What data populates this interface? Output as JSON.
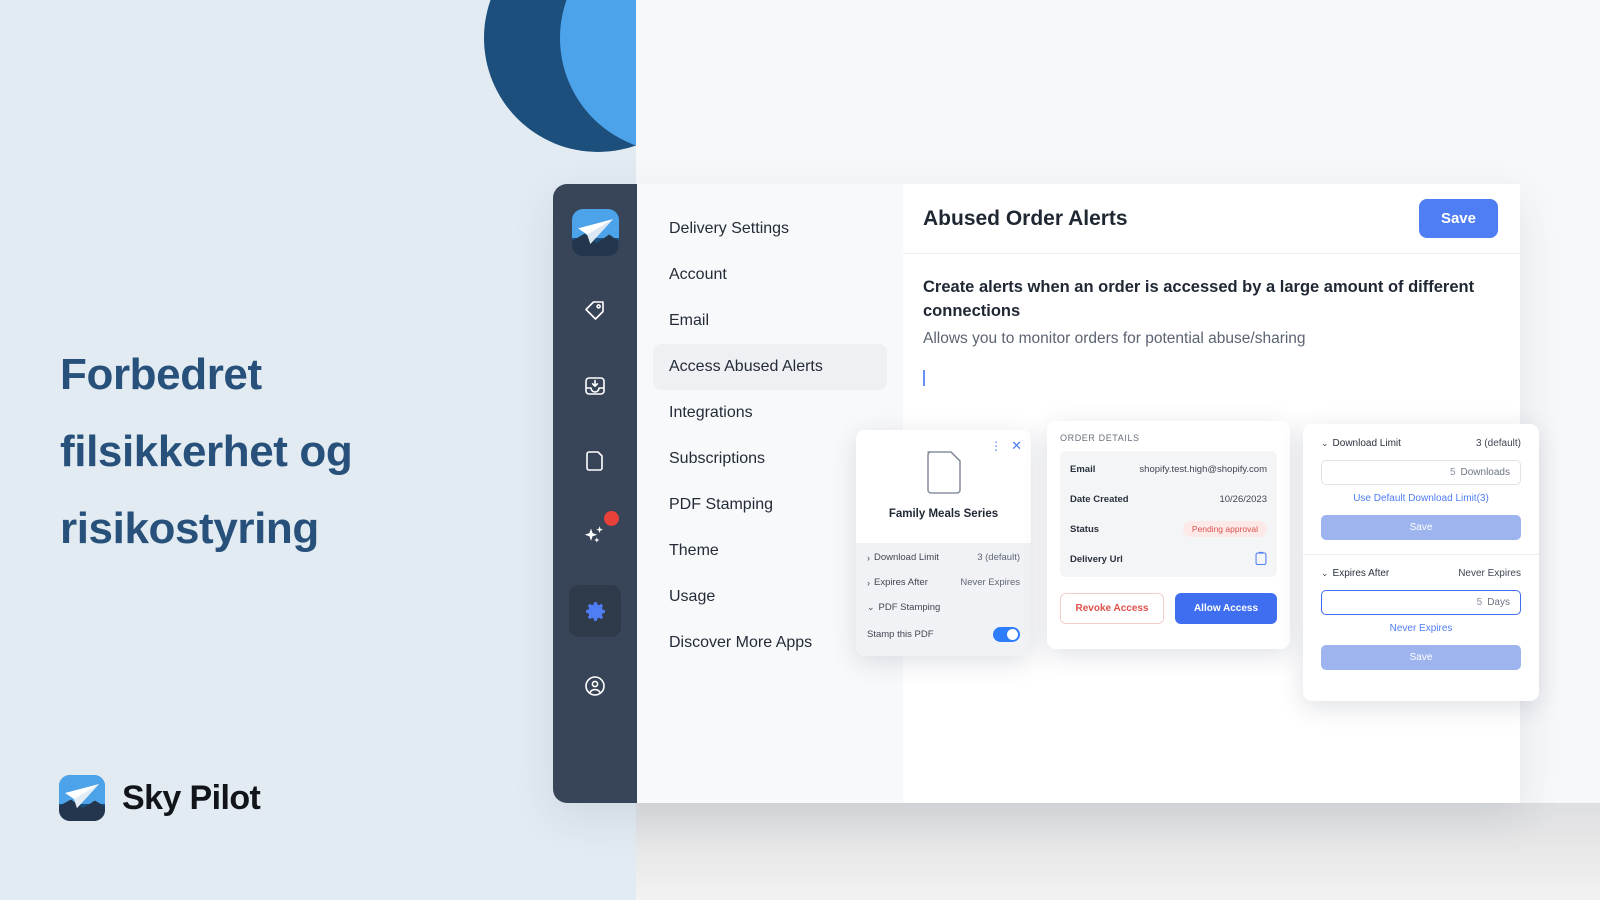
{
  "marketing": {
    "headline": "Forbedret filsikkerhet og risikostyring",
    "brand_name": "Sky Pilot",
    "brand_logo_icon": "paper-plane-logo-icon",
    "bg_color": "#e2ebf2",
    "headline_color": "#27517a",
    "circle_dark_color": "#1d4f7c",
    "circle_light_color": "#4da3ea"
  },
  "app": {
    "icon_rail": {
      "logo_icon": "sky-pilot-logo-icon",
      "items": [
        {
          "icon": "tag-icon",
          "active": false,
          "badge": false
        },
        {
          "icon": "inbox-download-icon",
          "active": false,
          "badge": false
        },
        {
          "icon": "document-icon",
          "active": false,
          "badge": false
        },
        {
          "icon": "sparkles-icon",
          "active": false,
          "badge": true
        },
        {
          "icon": "gear-icon",
          "active": true,
          "badge": false
        },
        {
          "icon": "account-circle-icon",
          "active": false,
          "badge": false
        }
      ],
      "active_icon_color": "#4f7df3",
      "badge_color": "#e8413a",
      "rail_bg": "#384457"
    },
    "settings_menu": {
      "items": [
        {
          "label": "Delivery Settings",
          "active": false
        },
        {
          "label": "Account",
          "active": false
        },
        {
          "label": "Email",
          "active": false
        },
        {
          "label": "Access Abused Alerts",
          "active": true
        },
        {
          "label": "Integrations",
          "active": false
        },
        {
          "label": "Subscriptions",
          "active": false
        },
        {
          "label": "PDF Stamping",
          "active": false
        },
        {
          "label": "Theme",
          "active": false
        },
        {
          "label": "Usage",
          "active": false
        },
        {
          "label": "Discover More Apps",
          "active": false
        }
      ]
    },
    "content": {
      "title": "Abused Order Alerts",
      "save_label": "Save",
      "save_color": "#4f7df3",
      "heading": "Create alerts when an order is accessed by a large amount of different connections",
      "subtext": "Allows you to monitor orders for potential abuse/sharing"
    }
  },
  "cards": {
    "product": {
      "menu_icon": "vertical-dots-icon",
      "close_icon": "close-icon",
      "file_icon": "document-icon",
      "name": "Family Meals Series",
      "rows": [
        {
          "label": "Download Limit",
          "value": "3 (default)",
          "chevron": "chevron-right-icon"
        },
        {
          "label": "Expires After",
          "value": "Never Expires",
          "chevron": "chevron-right-icon"
        },
        {
          "label": "PDF Stamping",
          "value": "",
          "chevron": "chevron-down-icon"
        }
      ],
      "toggle_label": "Stamp this PDF",
      "toggle_on": true,
      "toggle_color": "#2e7dfa"
    },
    "order_details": {
      "eyebrow": "ORDER DETAILS",
      "rows": [
        {
          "key": "Email",
          "value": "shopify.test.high@shopify.com",
          "type": "text"
        },
        {
          "key": "Date Created",
          "value": "10/26/2023",
          "type": "text"
        },
        {
          "key": "Status",
          "value": "Pending approval",
          "type": "badge"
        },
        {
          "key": "Delivery Url",
          "value": "",
          "type": "copy-icon"
        }
      ],
      "badge_color": "#d9534f",
      "badge_bg": "#fde9e7",
      "copy_icon": "clipboard-copy-icon",
      "revoke_label": "Revoke Access",
      "allow_label": "Allow Access",
      "allow_color": "#3f6ef0",
      "revoke_color": "#e0514a"
    },
    "limits": {
      "download_limit": {
        "label": "Download Limit",
        "value": "3 (default)",
        "chevron": "chevron-down-icon",
        "input_number": "5",
        "input_unit": "Downloads",
        "link": "Use Default Download Limit(3)",
        "save_label": "Save",
        "focused": false
      },
      "expires_after": {
        "label": "Expires After",
        "value": "Never Expires",
        "chevron": "chevron-down-icon",
        "input_number": "5",
        "input_unit": "Days",
        "link": "Never Expires",
        "save_label": "Save",
        "focused": true
      },
      "save_color": "#9db4ee",
      "link_color": "#4f7df3"
    }
  }
}
